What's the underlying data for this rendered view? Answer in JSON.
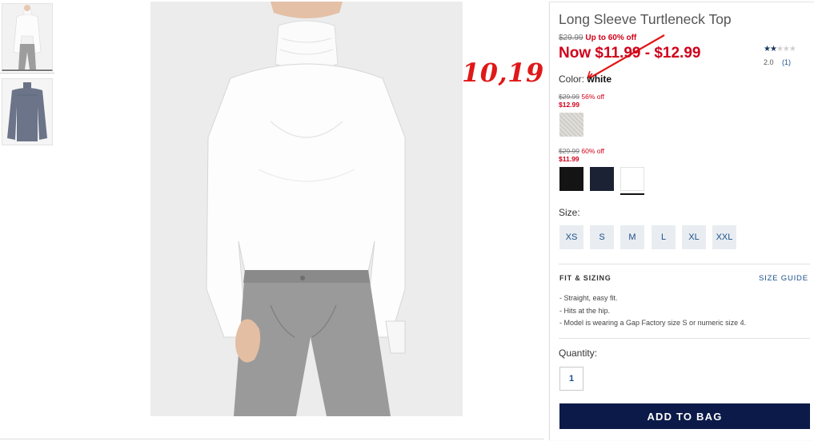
{
  "product": {
    "title": "Long Sleeve Turtleneck Top",
    "original_price": "$29.99",
    "discount_text": "Up to 60% off",
    "now_price": "Now $11.99 - $12.99",
    "rating_value": "2.0",
    "rating_count": "(1)",
    "rating_stars": 2,
    "rating_max": 5
  },
  "annotation": {
    "text": "10,19",
    "color": "#e01818"
  },
  "color": {
    "label": "Color:",
    "selected": "white"
  },
  "price_groups": [
    {
      "was": "$29.99",
      "off": "56% off",
      "now": "$12.99"
    },
    {
      "was": "$29.99",
      "off": "60% off",
      "now": "$11.99"
    }
  ],
  "swatches": {
    "heather": "#d7d4ce",
    "black": "#141414",
    "navy": "#1a2233",
    "white": "#ffffff"
  },
  "size": {
    "label": "Size:",
    "options": [
      "XS",
      "S",
      "M",
      "L",
      "XL",
      "XXL"
    ]
  },
  "fit": {
    "title": "FIT & SIZING",
    "size_guide": "SIZE GUIDE",
    "bullets": [
      "- Straight, easy fit.",
      "- Hits at the hip.",
      "- Model is wearing a Gap Factory size S or numeric size 4."
    ]
  },
  "quantity": {
    "label": "Quantity:",
    "value": "1"
  },
  "cta": {
    "add_to_bag": "ADD TO BAG"
  },
  "colors": {
    "sale_red": "#d0021b",
    "link_blue": "#1b4f8a",
    "button_navy": "#0b1a48",
    "size_bg": "#e9edf1"
  }
}
